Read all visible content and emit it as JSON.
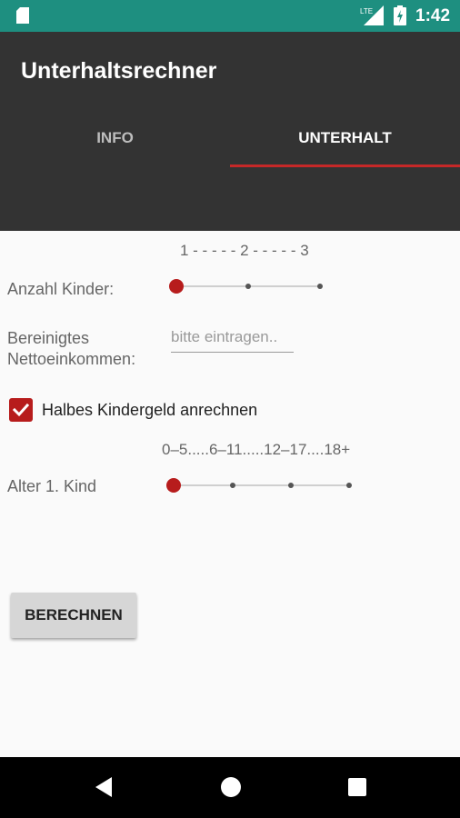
{
  "status_bar": {
    "time": "1:42",
    "network": "LTE"
  },
  "app_bar": {
    "title": "Unterhaltsrechner"
  },
  "tabs": [
    {
      "label": "INFO",
      "selected": false
    },
    {
      "label": "UNTERHALT",
      "selected": true
    }
  ],
  "kids_count": {
    "label": "Anzahl Kinder:",
    "scale": "1 - - - - - 2 - - - - - 3",
    "options": [
      "1",
      "2",
      "3"
    ],
    "selected": "1"
  },
  "net_income": {
    "label_line1": "Bereinigtes",
    "label_line2": "Nettoeinkommen:",
    "placeholder": "bitte eintragen..",
    "value": ""
  },
  "child_benefit": {
    "label": "Halbes Kindergeld anrechnen",
    "checked": true
  },
  "age_first_child": {
    "label": "Alter 1. Kind",
    "scale": "0–5.....6–11.....12–17....18+",
    "options": [
      "0–5",
      "6–11",
      "12–17",
      "18+"
    ],
    "selected": "0–5"
  },
  "calculate_button": {
    "label": "BERECHNEN"
  },
  "colors": {
    "status_bar": "#1e8f80",
    "app_bar": "#333333",
    "accent": "#b71c1c"
  }
}
